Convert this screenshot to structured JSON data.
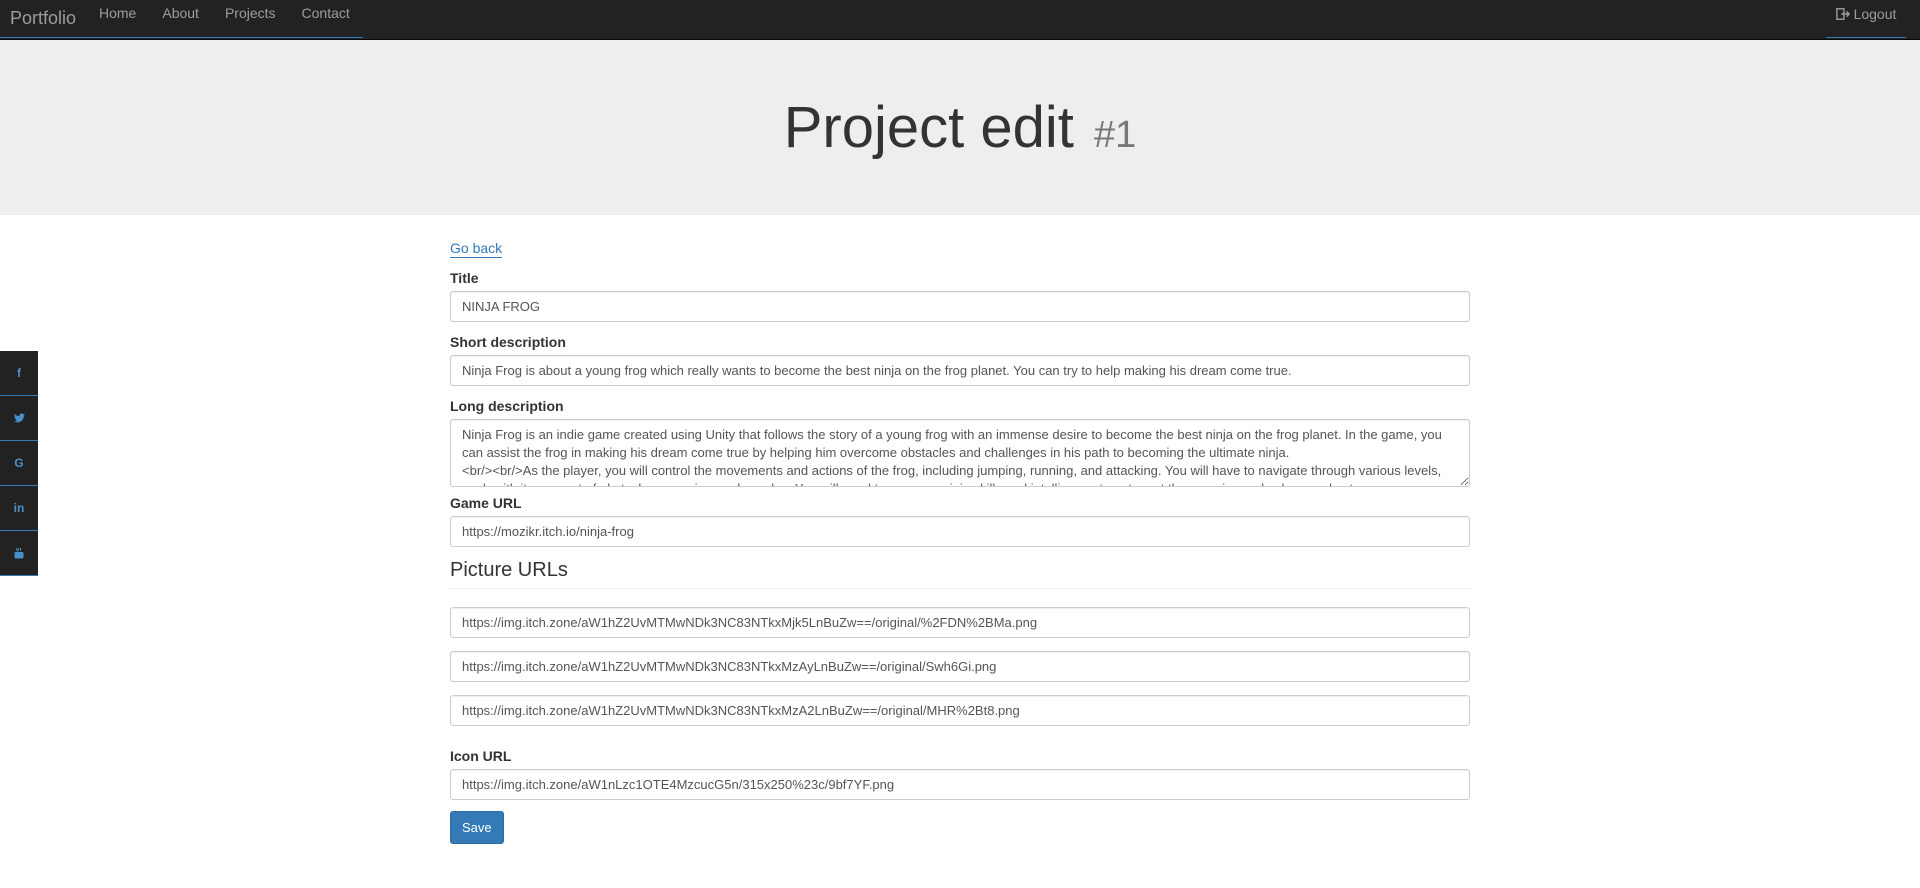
{
  "navbar": {
    "brand": "Portfolio",
    "links": [
      "Home",
      "About",
      "Projects",
      "Contact"
    ],
    "logout": "Logout"
  },
  "jumbotron": {
    "title": "Project edit",
    "id_label": "#1"
  },
  "social": [
    "f",
    "t",
    "G",
    "in",
    "yt"
  ],
  "form": {
    "go_back": "Go back",
    "title_label": "Title",
    "title_value": "NINJA FROG",
    "short_label": "Short description",
    "short_value": "Ninja Frog is about a young frog which really wants to become the best ninja on the frog planet. You can try to help making his dream come true.",
    "long_label": "Long description",
    "long_value": "Ninja Frog is an indie game created using Unity that follows the story of a young frog with an immense desire to become the best ninja on the frog planet. In the game, you can assist the frog in making his dream come true by helping him overcome obstacles and challenges in his path to becoming the ultimate ninja.\n<br/><br/>As the player, you will control the movements and actions of the frog, including jumping, running, and attacking. You will have to navigate through various levels, each with its own set of obstacles, enemies, and puzzles. You will need to use your ninja skills and intelligence to outsmart the enemies and solve puzzles to progress through the game.",
    "game_url_label": "Game URL",
    "game_url_value": "https://mozikr.itch.io/ninja-frog",
    "pictures_title": "Picture URLs",
    "pictures": [
      "https://img.itch.zone/aW1hZ2UvMTMwNDk3NC83NTkxMjk5LnBuZw==/original/%2FDN%2BMa.png",
      "https://img.itch.zone/aW1hZ2UvMTMwNDk3NC83NTkxMzAyLnBuZw==/original/Swh6Gi.png",
      "https://img.itch.zone/aW1hZ2UvMTMwNDk3NC83NTkxMzA2LnBuZw==/original/MHR%2Bt8.png"
    ],
    "icon_label": "Icon URL",
    "icon_value": "https://img.itch.zone/aW1nLzc1OTE4MzcucG5n/315x250%23c/9bf7YF.png",
    "save": "Save"
  },
  "colors": {
    "navbar": "#222222",
    "accent": "#337ab7",
    "jumbotron": "#eeeeee"
  }
}
